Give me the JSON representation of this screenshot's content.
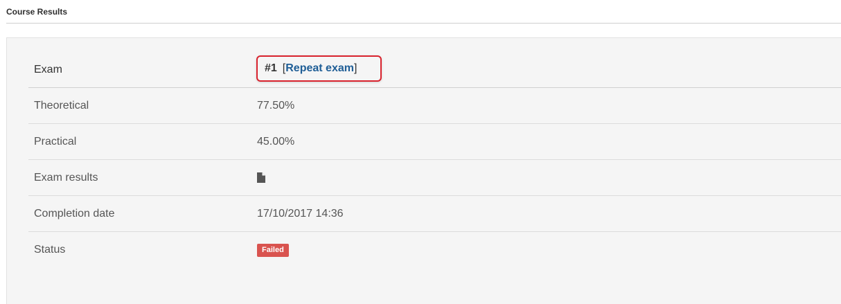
{
  "header": {
    "title": "Course Results"
  },
  "results": {
    "exam": {
      "label": "Exam",
      "number": "#1",
      "bracket_open": "[",
      "repeat_link": "Repeat exam",
      "bracket_close": "]"
    },
    "theoretical": {
      "label": "Theoretical",
      "value": "77.50%"
    },
    "practical": {
      "label": "Practical",
      "value": "45.00%"
    },
    "exam_results": {
      "label": "Exam results",
      "icon": "document-icon"
    },
    "completion_date": {
      "label": "Completion date",
      "value": "17/10/2017 14:36"
    },
    "status": {
      "label": "Status",
      "value": "Failed",
      "color": "#d9534f"
    }
  },
  "colors": {
    "link": "#1f5e96",
    "highlight_border": "#d9232e",
    "panel_background": "#f5f5f5"
  }
}
